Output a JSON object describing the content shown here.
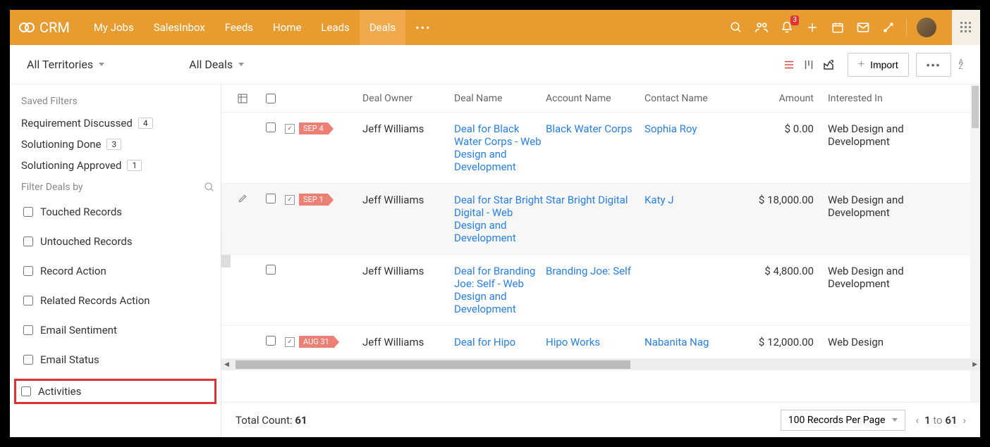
{
  "app": {
    "name": "CRM"
  },
  "nav": {
    "items": [
      "My Jobs",
      "SalesInbox",
      "Feeds",
      "Home",
      "Leads",
      "Deals"
    ],
    "active_index": 5,
    "notif_count": "3"
  },
  "toolbar": {
    "territory": "All Territories",
    "deals_filter": "All Deals",
    "import_label": "Import"
  },
  "sidebar": {
    "saved_title": "Saved Filters",
    "saved": [
      {
        "label": "Requirement Discussed",
        "count": "4"
      },
      {
        "label": "Solutioning Done",
        "count": "3"
      },
      {
        "label": "Solutioning Approved",
        "count": "1"
      }
    ],
    "filter_by_title": "Filter Deals by",
    "filters": [
      "Touched Records",
      "Untouched Records",
      "Record Action",
      "Related Records Action",
      "Email Sentiment",
      "Email Status",
      "Activities"
    ],
    "highlighted_index": 6
  },
  "table": {
    "headers": {
      "owner": "Deal Owner",
      "deal": "Deal Name",
      "account": "Account Name",
      "contact": "Contact Name",
      "amount": "Amount",
      "interest": "Interested In"
    },
    "rows": [
      {
        "flag": "SEP 4",
        "owner": "Jeff Williams",
        "deal": "Deal for Black Water Corps - Web Design and Development",
        "account": "Black Water Corps",
        "contact": "Sophia Roy",
        "amount": "$ 0.00",
        "interest": "Web Design and Development"
      },
      {
        "flag": "SEP 1",
        "owner": "Jeff Williams",
        "deal": "Deal for Star Bright Digital - Web Design and Development",
        "account": "Star Bright Digital",
        "contact": "Katy J",
        "amount": "$ 18,000.00",
        "interest": "Web Design and Development",
        "hover": true
      },
      {
        "flag": "",
        "owner": "Jeff Williams",
        "deal": "Deal for Branding Joe: Self - Web Design and Development",
        "account": "Branding Joe: Self",
        "contact": "",
        "amount": "$ 4,800.00",
        "interest": "Web Design and Development"
      },
      {
        "flag": "AUG 31",
        "owner": "Jeff Williams",
        "deal": "Deal for Hipo",
        "account": "Hipo Works",
        "contact": "Nabanita Nag",
        "amount": "$ 12,000.00",
        "interest": "Web Design"
      }
    ]
  },
  "footer": {
    "total_label": "Total Count:",
    "total": "61",
    "per_page": "100 Records Per Page",
    "page_from": "1",
    "page_sep": "to",
    "page_to": "61"
  }
}
